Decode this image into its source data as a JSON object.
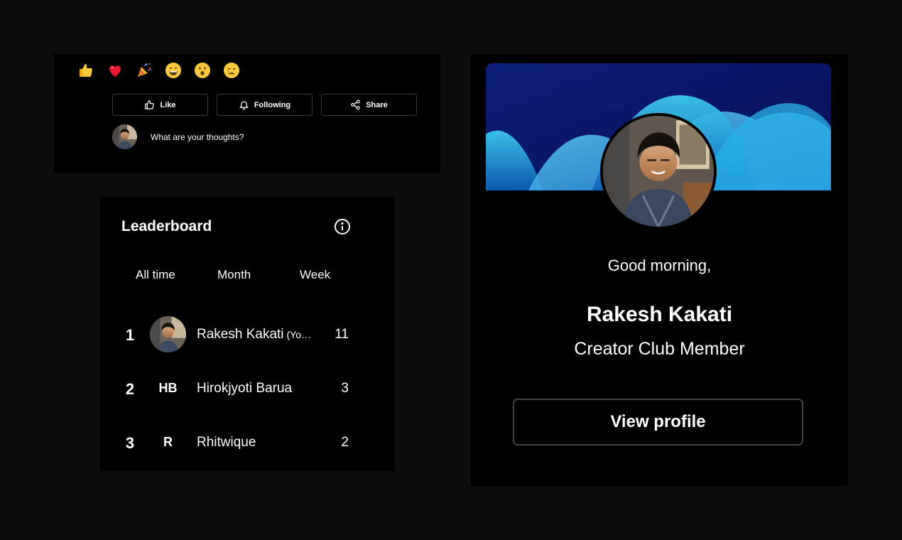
{
  "post": {
    "reactions": [
      {
        "emoji": "👍",
        "icon": "thumbs-up-icon"
      },
      {
        "emoji": "❤️",
        "icon": "heart-icon"
      },
      {
        "emoji": "🎉",
        "icon": "party-popper-icon"
      },
      {
        "emoji": "😄",
        "icon": "grinning-face-icon"
      },
      {
        "emoji": "😮",
        "icon": "surprised-face-icon"
      },
      {
        "emoji": "😢",
        "icon": "crying-face-icon"
      }
    ],
    "actions": {
      "like": "Like",
      "following": "Following",
      "share": "Share"
    },
    "comment_placeholder": "What are your thoughts?"
  },
  "leaderboard": {
    "title": "Leaderboard",
    "tabs": [
      "All time",
      "Month",
      "Week"
    ],
    "entries": [
      {
        "rank": "1",
        "name": "Rakesh Kakati",
        "tag": "(Yo…",
        "initials": "",
        "score": "11",
        "avatar": "photo"
      },
      {
        "rank": "2",
        "name": "Hirokjyoti Barua",
        "tag": "",
        "initials": "HB",
        "score": "3",
        "avatar": "initials"
      },
      {
        "rank": "3",
        "name": "Rhitwique",
        "tag": "",
        "initials": "R",
        "score": "2",
        "avatar": "initials"
      }
    ]
  },
  "profile": {
    "greeting": "Good morning,",
    "name": "Rakesh Kakati",
    "role": "Creator Club Member",
    "view_profile_label": "View profile"
  },
  "colors": {
    "page_background": "#0d0d0d",
    "panel_background": "#000000",
    "border": "#3b3b3b",
    "banner_dark": "#0a1a6b",
    "banner_accent": "#38c6f0"
  }
}
